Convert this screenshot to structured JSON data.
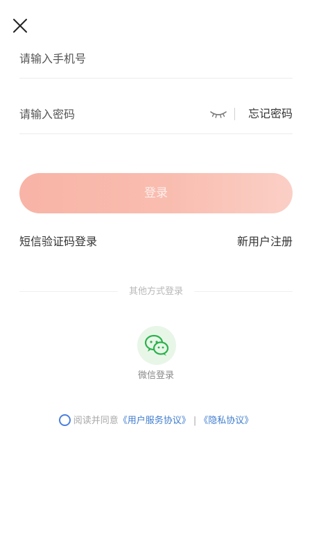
{
  "close_icon": "close-icon",
  "phone_field": {
    "placeholder": "请输入手机号",
    "value": ""
  },
  "password_field": {
    "placeholder": "请输入密码",
    "value": ""
  },
  "eye_icon": "eye-closed-icon",
  "forgot_password": "忘记密码",
  "login_button": "登录",
  "sms_login": "短信验证码登录",
  "register": "新用户注册",
  "other_methods_title": "其他方式登录",
  "wechat": {
    "label": "微信登录",
    "icon": "wechat-icon",
    "color": "#2bb24c"
  },
  "agreement": {
    "prefix": "阅读并同意",
    "user_agreement": "《用户服务协议》",
    "separator": "|",
    "privacy_policy": "《隐私协议》",
    "link_color": "#3f7ccf"
  },
  "colors": {
    "login_button": "#f9bdb0",
    "checkbox": "#4a7ee0"
  }
}
